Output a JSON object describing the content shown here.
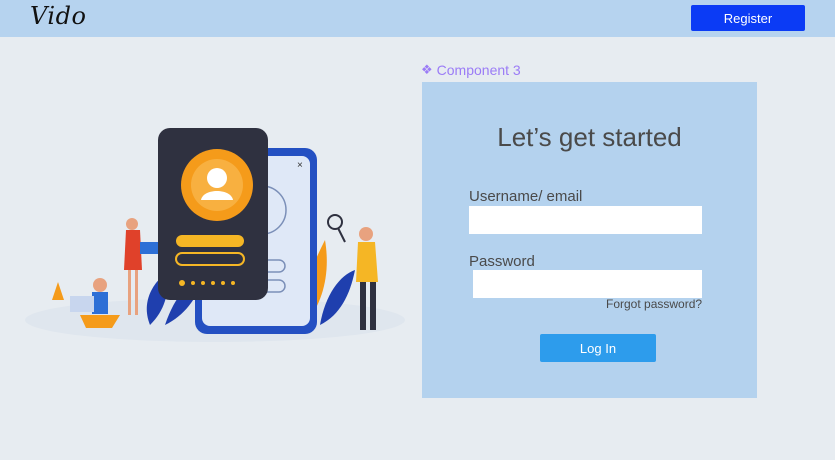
{
  "header": {
    "logo_text": "Vido",
    "register_label": "Register"
  },
  "component": {
    "label": "Component 3",
    "icon": "component-icon"
  },
  "login": {
    "title": "Let’s get started",
    "username_label": "Username/ email",
    "username_value": "",
    "password_label": "Password",
    "password_value": "",
    "forgot_label": "Forgot password?",
    "login_label": "Log In"
  },
  "colors": {
    "topbar": "#b6d3ef",
    "register": "#0b3bf5",
    "card": "#b4d2ee",
    "login_button": "#2d9cec",
    "component_label": "#9b7cf6"
  }
}
